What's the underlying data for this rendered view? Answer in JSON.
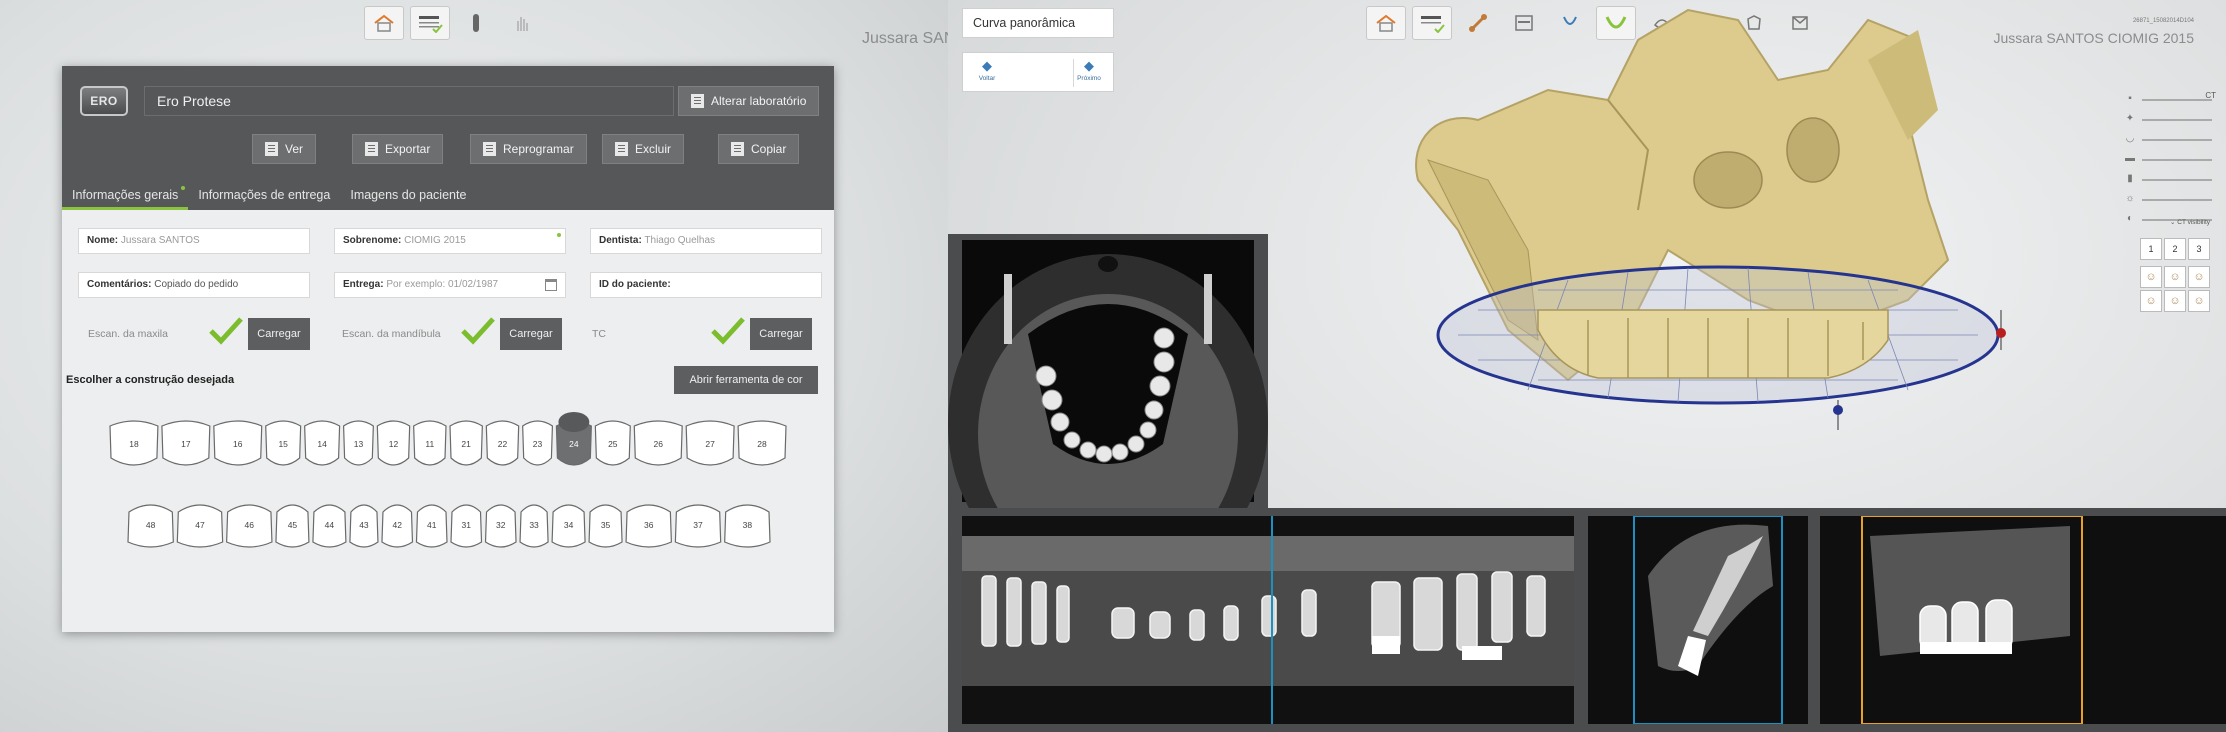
{
  "left_app": {
    "user_name_clipped": "Jussara SANT",
    "toolbar": {
      "icons": [
        "home-icon",
        "order-form-icon",
        "implant-icon",
        "hand-icon"
      ]
    },
    "header": {
      "logo_text": "ERO",
      "lab_name": "Ero Protese",
      "change_lab_label": "Alterar laboratório",
      "actions": [
        "Ver",
        "Exportar",
        "Reprogramar",
        "Excluir",
        "Copiar"
      ]
    },
    "tabs": [
      "Informações gerais",
      "Informações de entrega",
      "Imagens do paciente"
    ],
    "form": {
      "nome_label": "Nome:",
      "nome_value": "Jussara SANTOS",
      "sobrenome_label": "Sobrenome:",
      "sobrenome_value": "CIOMIG 2015",
      "dentista_label": "Dentista:",
      "dentista_value": "Thiago Quelhas",
      "comentarios_label": "Comentários:",
      "comentarios_value": "Copiado do pedido",
      "entrega_label": "Entrega:",
      "entrega_placeholder": "Por exemplo: 01/02/1987",
      "id_label": "ID do paciente:",
      "id_value": ""
    },
    "scans": [
      {
        "label": "Escan. da maxila",
        "button": "Carregar"
      },
      {
        "label": "Escan. da mandíbula",
        "button": "Carregar"
      },
      {
        "label": "TC",
        "button": "Carregar"
      }
    ],
    "construction_title": "Escolher a construção desejada",
    "color_tool_label": "Abrir ferramenta de cor",
    "upper_teeth": [
      "18",
      "17",
      "16",
      "15",
      "14",
      "13",
      "12",
      "11",
      "21",
      "22",
      "23",
      "24",
      "25",
      "26",
      "27",
      "28"
    ],
    "lower_teeth": [
      "48",
      "47",
      "46",
      "45",
      "44",
      "43",
      "42",
      "41",
      "31",
      "32",
      "33",
      "34",
      "35",
      "36",
      "37",
      "38"
    ],
    "selected_tooth": "24"
  },
  "right_app": {
    "view_mode": "Curva panorâmica",
    "nav_prev": "Voltar",
    "nav_next": "Próximo",
    "tools": [
      "home-icon",
      "order-form-icon",
      "bone-icon",
      "panorama-icon",
      "nerve-icon",
      "arch-curve-icon",
      "occlusal-icon",
      "implant-icon",
      "crown-icon",
      "report-icon"
    ],
    "patient_id": "26871_15082014D104",
    "patient_name": "Jussara SANTOS CIOMIG 2015",
    "slider_end_label": "CT",
    "ct_visibility_label": "CT visibility",
    "layout_buttons": [
      "1",
      "2",
      "3"
    ],
    "accent_blue": "#1e8fc0",
    "accent_orange": "#e8a028",
    "bone_color": "#dccb8c"
  }
}
